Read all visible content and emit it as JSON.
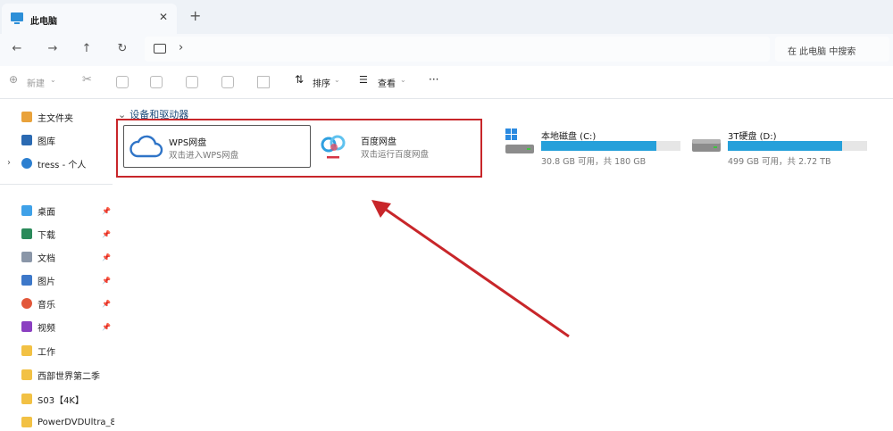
{
  "tab": {
    "title": "此电脑",
    "close": "✕",
    "new": "+"
  },
  "nav": {
    "back": "←",
    "forward": "→",
    "up": "↑",
    "refresh": "↻",
    "chevron": "›"
  },
  "search": {
    "placeholder": "在 此电脑 中搜索"
  },
  "toolbar": {
    "new_label": "新建",
    "sort_label": "排序",
    "view_label": "查看",
    "more_label": "···"
  },
  "sidebar": {
    "items": [
      {
        "label": "主文件夹",
        "icon": "home-icon"
      },
      {
        "label": "图库",
        "icon": "gallery-icon"
      },
      {
        "label": "tress - 个人",
        "icon": "cloud-icon"
      },
      {
        "label": "桌面",
        "icon": "desktop-icon"
      },
      {
        "label": "下载",
        "icon": "download-icon"
      },
      {
        "label": "文档",
        "icon": "document-icon"
      },
      {
        "label": "图片",
        "icon": "pictures-icon"
      },
      {
        "label": "音乐",
        "icon": "music-icon"
      },
      {
        "label": "视频",
        "icon": "video-icon"
      },
      {
        "label": "工作",
        "icon": "folder-icon"
      },
      {
        "label": "西部世界第二季",
        "icon": "folder-icon"
      },
      {
        "label": "S03【4K】",
        "icon": "folder-icon"
      },
      {
        "label": "PowerDVDUltra_8",
        "icon": "folder-icon"
      }
    ]
  },
  "main": {
    "group_header": "设备和驱动器",
    "tiles": [
      {
        "name": "WPS网盘",
        "sub": "双击进入WPS网盘"
      },
      {
        "name": "百度网盘",
        "sub": "双击运行百度网盘"
      }
    ],
    "drives": [
      {
        "name": "本地磁盘 (C:)",
        "info": "30.8 GB 可用，共 180 GB",
        "used_fraction": 0.83
      },
      {
        "name": "3T硬盘 (D:)",
        "info": "499 GB 可用，共 2.72 TB",
        "used_fraction": 0.82
      }
    ]
  },
  "colors": {
    "accent": "#26a0da",
    "highlight": "#c8262a"
  }
}
